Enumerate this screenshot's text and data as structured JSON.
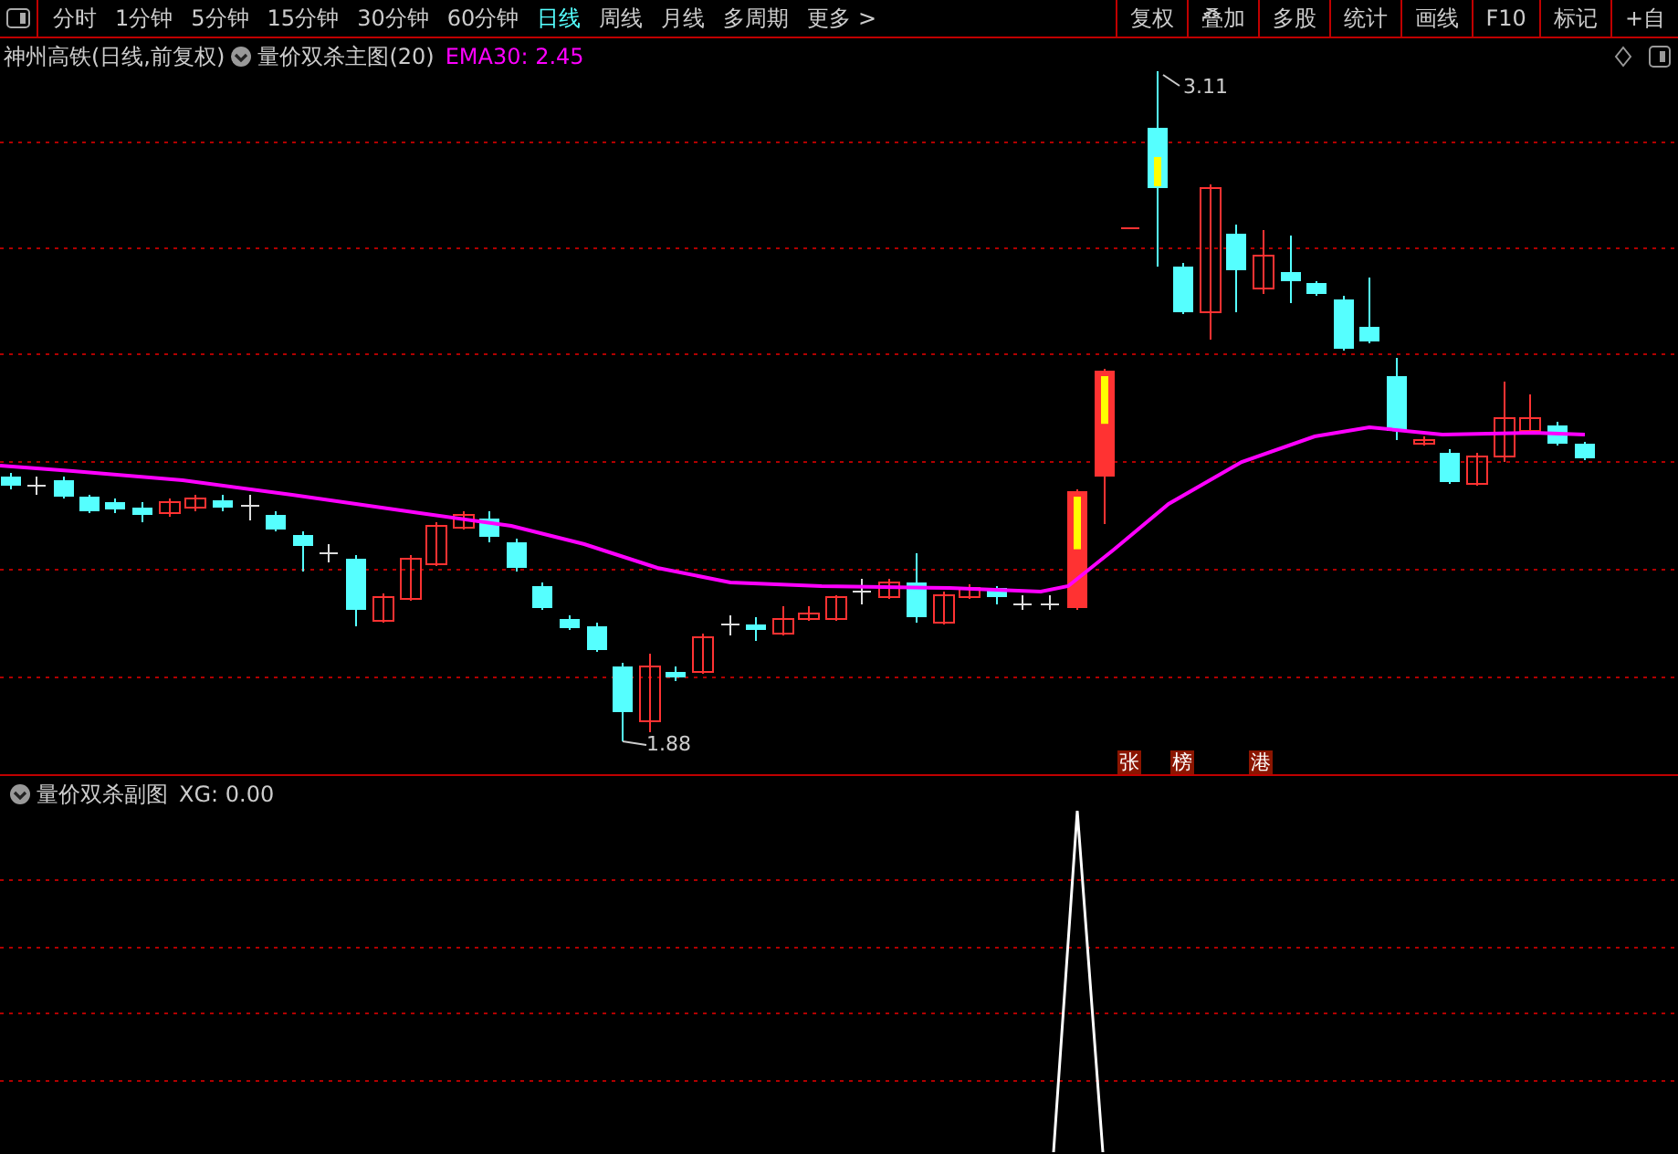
{
  "toolbar": {
    "periods": [
      {
        "label": "分时",
        "selected": false
      },
      {
        "label": "1分钟",
        "selected": false
      },
      {
        "label": "5分钟",
        "selected": false
      },
      {
        "label": "15分钟",
        "selected": false
      },
      {
        "label": "30分钟",
        "selected": false
      },
      {
        "label": "60分钟",
        "selected": false
      },
      {
        "label": "日线",
        "selected": true
      },
      {
        "label": "周线",
        "selected": false
      },
      {
        "label": "月线",
        "selected": false
      },
      {
        "label": "多周期",
        "selected": false
      },
      {
        "label": "更多 >",
        "selected": false
      }
    ],
    "tools": [
      "复权",
      "叠加",
      "多股",
      "统计",
      "画线",
      "F10",
      "标记",
      "+自"
    ]
  },
  "main_chart": {
    "title": "神州高铁(日线,前复权)",
    "indicator": "量价双杀主图(20)",
    "ema": "EMA30: 2.45",
    "high_label": "3.11",
    "low_label": "1.88",
    "markers": [
      "张",
      "榜",
      "港"
    ]
  },
  "sub_chart": {
    "indicator": "量价双杀副图",
    "value": "XG: 0.00"
  }
}
